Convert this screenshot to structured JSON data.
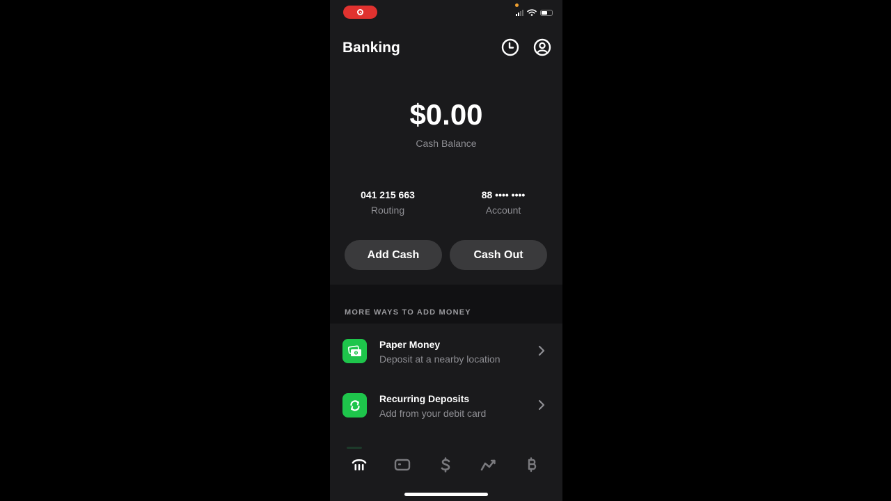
{
  "status_bar": {
    "recording_icon": "screen-record-icon",
    "colors": {
      "record_pill": "#e0322f",
      "privacy_dot": "#f0a030"
    }
  },
  "header": {
    "title": "Banking",
    "icons": [
      "clock-icon",
      "profile-icon"
    ]
  },
  "balance": {
    "amount": "$0.00",
    "label": "Cash Balance"
  },
  "account_info": {
    "routing": {
      "value": "041 215 663",
      "label": "Routing"
    },
    "account": {
      "value": "88 •••• ••••",
      "label": "Account"
    }
  },
  "actions": {
    "add_cash": "Add Cash",
    "cash_out": "Cash Out"
  },
  "more_ways": {
    "section_title": "MORE WAYS TO ADD MONEY",
    "items": [
      {
        "title": "Paper Money",
        "subtitle": "Deposit at a nearby location",
        "icon": "paper-money-icon"
      },
      {
        "title": "Recurring Deposits",
        "subtitle": "Add from your debit card",
        "icon": "recurring-icon"
      }
    ],
    "accent_color": "#1ec54b"
  },
  "tab_bar": {
    "tabs": [
      {
        "name": "banking",
        "icon": "bank-icon",
        "active": true
      },
      {
        "name": "card",
        "icon": "card-icon",
        "active": false
      },
      {
        "name": "pay",
        "icon": "dollar-icon",
        "active": false
      },
      {
        "name": "investing",
        "icon": "investing-icon",
        "active": false
      },
      {
        "name": "bitcoin",
        "icon": "bitcoin-icon",
        "active": false
      }
    ]
  }
}
